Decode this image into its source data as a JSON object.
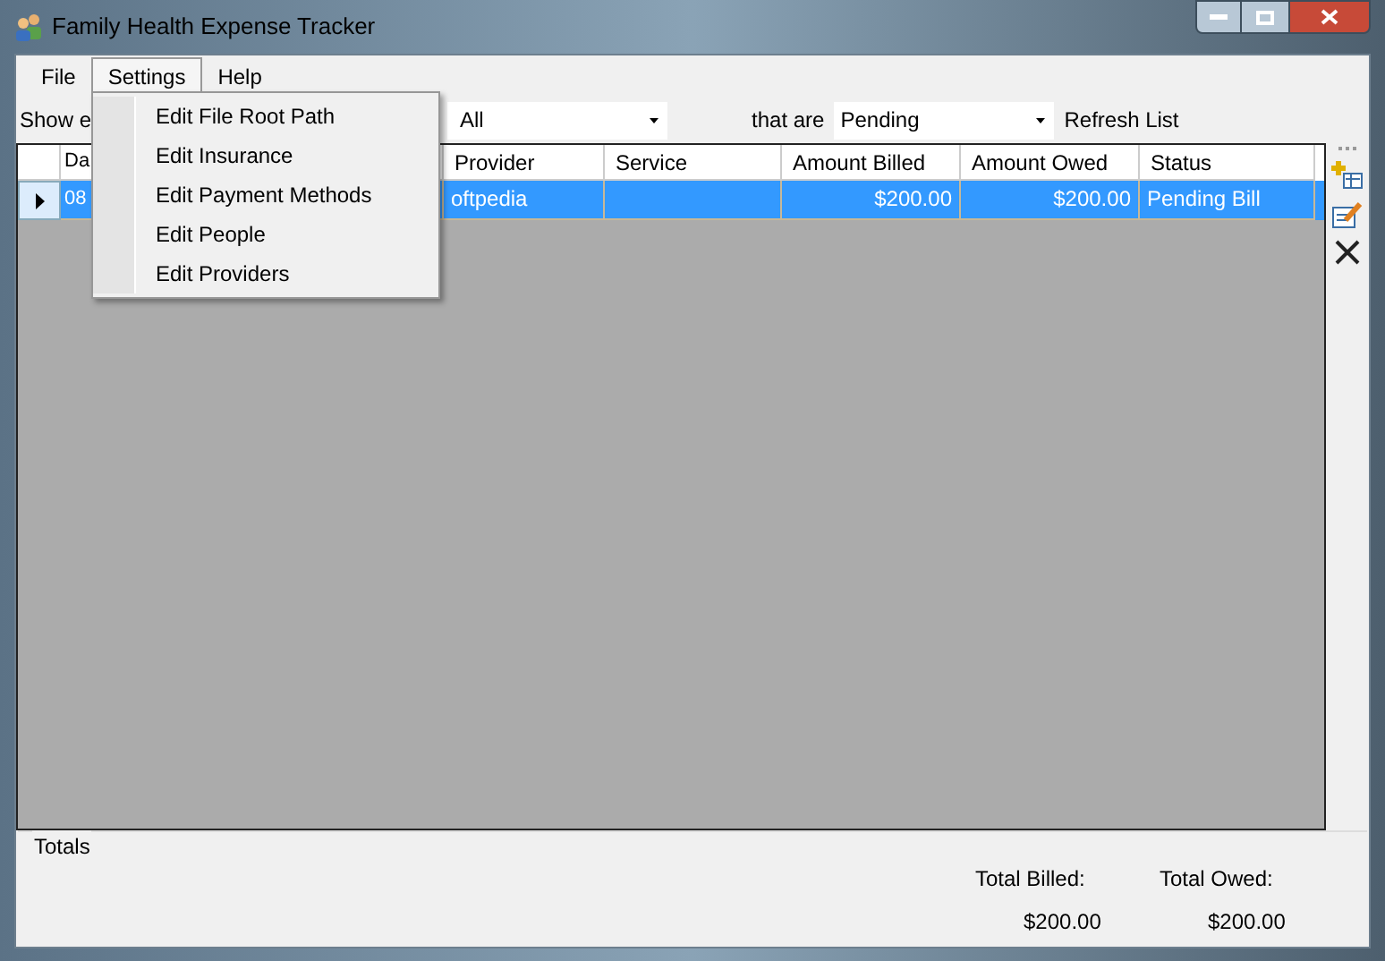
{
  "window": {
    "title": "Family Health Expense Tracker"
  },
  "menu_bar": [
    {
      "label": "File",
      "selected": false
    },
    {
      "label": "Settings",
      "selected": true
    },
    {
      "label": "Help",
      "selected": false
    }
  ],
  "settings_menu": [
    "Edit File Root Path",
    "Edit Insurance",
    "Edit Payment Methods",
    "Edit People",
    "Edit Providers"
  ],
  "filter_bar": {
    "show_label": "Show e",
    "person_combo": "All",
    "that_are_label": "that are",
    "status_combo": "Pending",
    "refresh_button": "Refresh List"
  },
  "table": {
    "columns": [
      "Da",
      "Provider",
      "Service",
      "Amount Billed",
      "Amount Owed",
      "Status"
    ],
    "rows": [
      {
        "selected": true,
        "cells": [
          "08",
          "oftpedia",
          "",
          "$200.00",
          "$200.00",
          "Pending Bill"
        ]
      }
    ]
  },
  "totals": {
    "title": "Totals",
    "billed_label": "Total Billed:",
    "billed_value": "$200.00",
    "owed_label": "Total Owed:",
    "owed_value": "$200.00"
  }
}
